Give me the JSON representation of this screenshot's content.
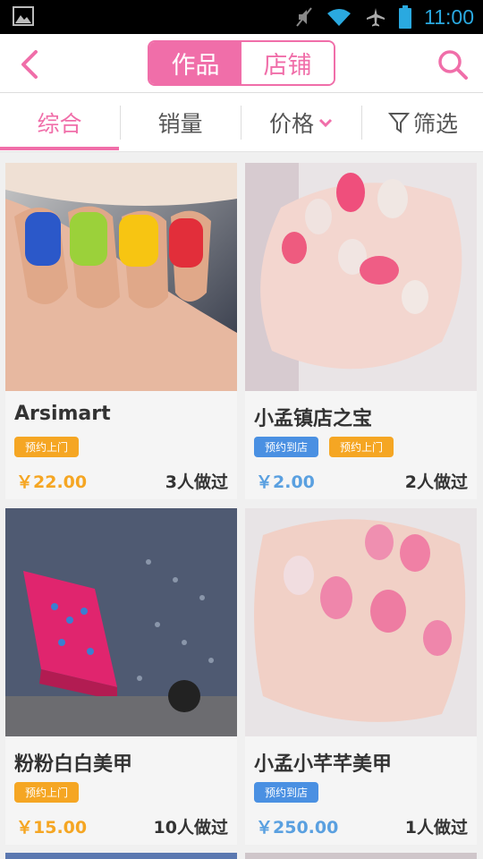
{
  "status_bar": {
    "time": "11:00"
  },
  "header": {
    "segments": [
      "作品",
      "店铺"
    ],
    "active_segment": 0
  },
  "tabs": [
    {
      "label": "综合",
      "active": true
    },
    {
      "label": "销量",
      "active": false
    },
    {
      "label": "价格",
      "active": false
    },
    {
      "label": "筛选",
      "active": false
    }
  ],
  "colors": {
    "accent": "#f06ea9",
    "orange": "#f5a623",
    "blue": "#4a90e2"
  },
  "products": [
    {
      "title": "Arsimart",
      "badges": [
        {
          "text": "预约上门",
          "color": "orange"
        }
      ],
      "price": "￥22.00",
      "price_color": "orange",
      "count": "3人做过"
    },
    {
      "title": "小孟镇店之宝",
      "badges": [
        {
          "text": "预约到店",
          "color": "blue"
        },
        {
          "text": "预约上门",
          "color": "orange"
        }
      ],
      "price": "￥2.00",
      "price_color": "blue",
      "count": "2人做过"
    },
    {
      "title": "粉粉白白美甲",
      "badges": [
        {
          "text": "预约上门",
          "color": "orange"
        }
      ],
      "price": "￥15.00",
      "price_color": "orange",
      "count": "10人做过"
    },
    {
      "title": "小孟小芊芊美甲",
      "badges": [
        {
          "text": "预约到店",
          "color": "blue"
        }
      ],
      "price": "￥250.00",
      "price_color": "blue",
      "count": "1人做过"
    }
  ]
}
